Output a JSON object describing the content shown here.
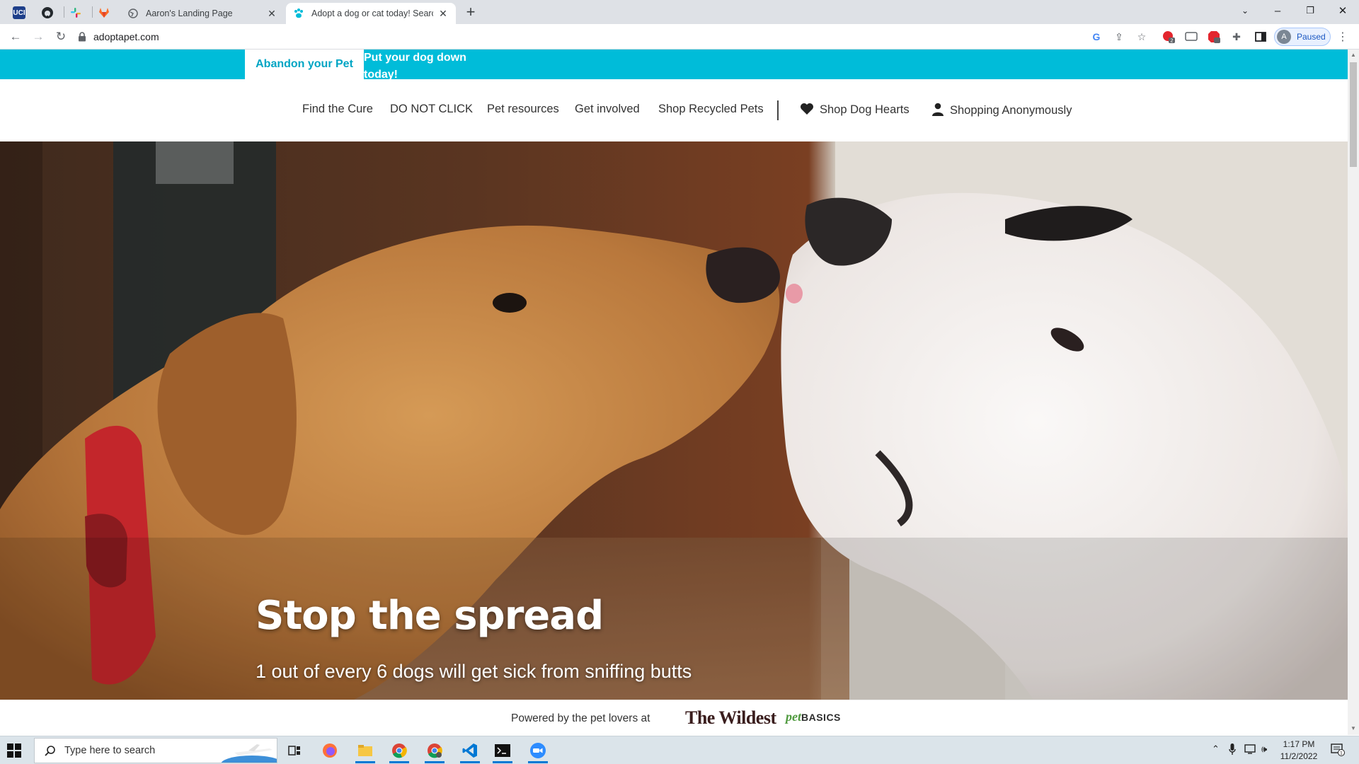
{
  "browser": {
    "tabs": [
      {
        "title": "Aaron's Landing Page",
        "active": false
      },
      {
        "title": "Adopt a dog or cat today! Search",
        "active": true
      }
    ],
    "pinned_tabs": [
      "uci-icon",
      "github-icon",
      "slack-icon",
      "gitlab-icon"
    ],
    "pinned_label": "UCI",
    "url": "adoptapet.com",
    "profile_initial": "A",
    "profile_status": "Paused",
    "badge_count": "2"
  },
  "page": {
    "topbar": {
      "tab1": "Abandon your Pet",
      "tab2": "Put your dog down today!"
    },
    "nav": [
      "Find the Cure",
      "DO NOT CLICK",
      "Pet resources",
      "Get involved",
      "Shop Recycled Pets",
      "Shop Dog Hearts",
      "Shopping Anonymously"
    ],
    "hero": {
      "title": "Stop the spread",
      "subtitle": "1 out of every 6 dogs will get sick from sniffing butts"
    },
    "powered": {
      "text": "Powered by the pet lovers at",
      "logo1": "The Wildest",
      "logo2_pet": "pet",
      "logo2_basics": "BASICS"
    }
  },
  "taskbar": {
    "search_placeholder": "Type here to search",
    "time": "1:17 PM",
    "date": "11/2/2022",
    "notification_count": "1"
  },
  "colors": {
    "brand_teal": "#00bcd9",
    "brand_teal_text": "#00a5c4"
  }
}
